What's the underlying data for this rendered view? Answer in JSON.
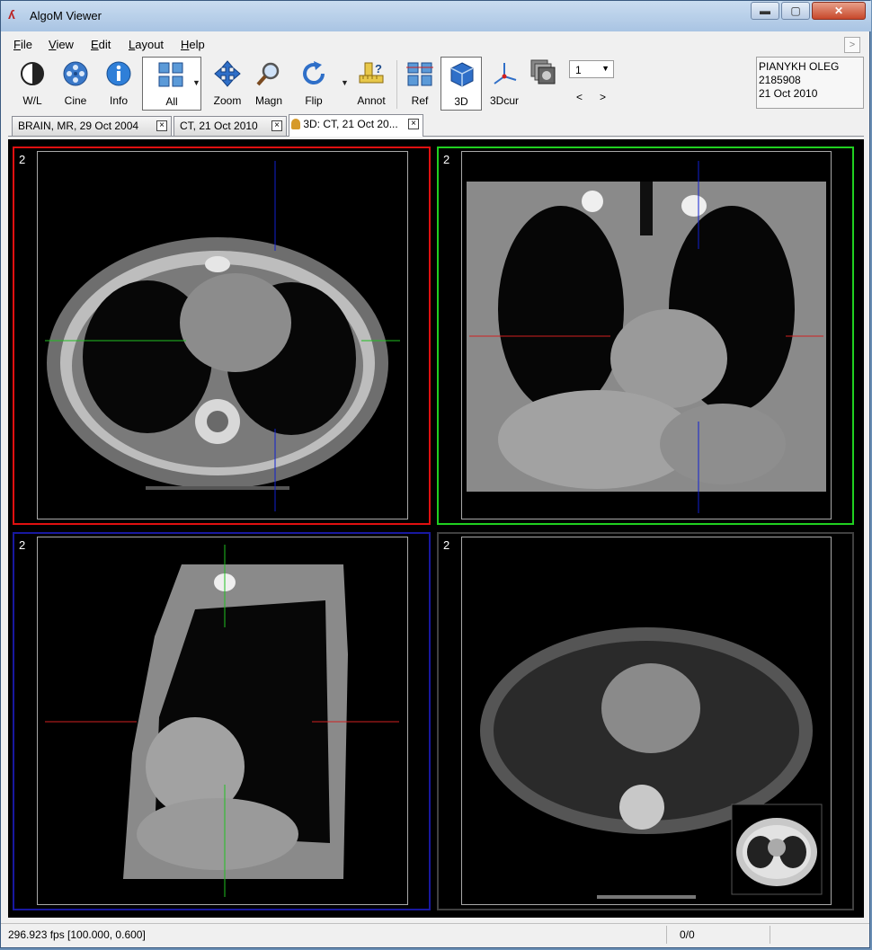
{
  "window": {
    "title": "AlgoM Viewer",
    "minimize": "▬",
    "maximize": "▢",
    "close": "✕",
    "app_icon": "algom-logo-icon"
  },
  "menu": [
    {
      "label": "File",
      "u": "F",
      "rest": "ile"
    },
    {
      "label": "View",
      "u": "V",
      "rest": "iew"
    },
    {
      "label": "Edit",
      "u": "E",
      "rest": "dit"
    },
    {
      "label": "Layout",
      "u": "L",
      "rest": "ayout"
    },
    {
      "label": "Help",
      "u": "H",
      "rest": "elp"
    }
  ],
  "expand_button": ">",
  "toolbar": [
    {
      "label": "W/L",
      "icon": "window-level-icon"
    },
    {
      "label": "Cine",
      "icon": "film-reel-icon"
    },
    {
      "label": "Info",
      "icon": "info-icon"
    },
    {
      "label": "All",
      "icon": "all-grid-icon",
      "active": true
    },
    {
      "label": "Zoom",
      "icon": "move-arrows-icon"
    },
    {
      "label": "Magn",
      "icon": "magnifier-icon"
    },
    {
      "label": "Flip",
      "icon": "rotate-icon"
    },
    {
      "label": "Annot",
      "icon": "ruler-question-icon"
    },
    {
      "label": "Ref",
      "icon": "reference-lines-icon"
    },
    {
      "label": "3D",
      "icon": "cube-icon",
      "active": true
    },
    {
      "label": "3Dcur",
      "icon": "3d-cursor-icon"
    }
  ],
  "layout_combo": {
    "value": "1"
  },
  "nav": {
    "prev": "<",
    "next": ">"
  },
  "patient": {
    "name": "PIANYKH OLEG",
    "id": "2185908",
    "date": "21 Oct 2010"
  },
  "tabs": [
    {
      "label": "BRAIN, MR, 29 Oct 2004"
    },
    {
      "label": "CT, 21 Oct 2010"
    },
    {
      "label": "3D: CT, 21 Oct 20...",
      "active": true
    }
  ],
  "viewports": [
    {
      "number": "2",
      "view": "axial",
      "border_color": "#e01010"
    },
    {
      "number": "2",
      "view": "coronal",
      "border_color": "#20d020"
    },
    {
      "number": "2",
      "view": "sagittal",
      "border_color": "#1818a0"
    },
    {
      "number": "2",
      "view": "volume-render",
      "border_color": "#404040"
    }
  ],
  "status": {
    "fps_text": "296.923 fps [100.000, 0.600]",
    "count": "0/0"
  }
}
